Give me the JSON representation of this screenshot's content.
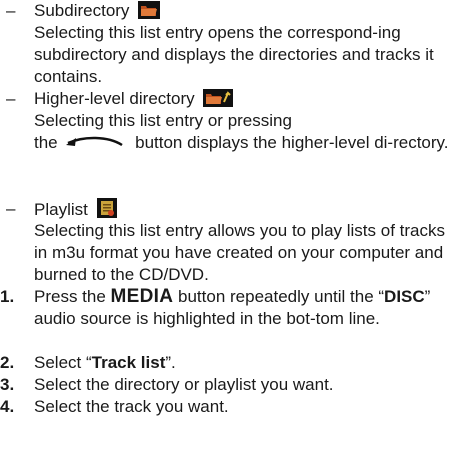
{
  "bullets": [
    {
      "dash": "–",
      "title": "Subdirectory",
      "icon": "folder-icon",
      "desc": "Selecting this list entry opens the correspond-ing subdirectory and displays the directories and tracks it contains."
    },
    {
      "dash": "–",
      "title": "Higher-level directory",
      "icon": "folder-up-icon",
      "desc_a": "Selecting this list entry or pressing",
      "desc_the": "the",
      "back_icon": "back-arrow-icon",
      "desc_b": "button displays the higher-level di-rectory."
    },
    {
      "dash": "–",
      "title": "Playlist",
      "icon": "playlist-icon",
      "desc": "Selecting this list entry allows you to play lists of tracks in m3u format you have created on your computer and burned to the CD/DVD."
    }
  ],
  "steps": [
    {
      "num": "1.",
      "pre": "Press the",
      "media": "MEDIA",
      "mid": "button repeatedly until the “",
      "disc": "DISC",
      "post": "” audio source is highlighted in the bot-tom line."
    },
    {
      "num": "2.",
      "pre": "Select “",
      "bold": "Track list",
      "post": "”."
    },
    {
      "num": "3.",
      "text": "Select the directory or playlist you want."
    },
    {
      "num": "4.",
      "text": "Select the track you want."
    }
  ],
  "colors": {
    "text": "#1a1a1a",
    "folder": "#c0521f",
    "playlist": "#c9a23b"
  }
}
